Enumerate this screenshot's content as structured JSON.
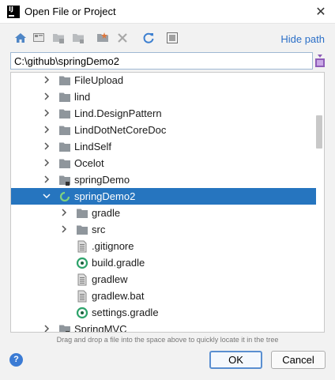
{
  "window": {
    "title": "Open File or Project",
    "close_glyph": "✕"
  },
  "toolbar": {
    "icons": [
      "home-icon",
      "desktop-icon",
      "project-folder-icon",
      "module-folder-icon",
      "new-folder-icon",
      "delete-icon",
      "refresh-icon",
      "show-hidden-icon"
    ],
    "hide_path_label": "Hide path"
  },
  "path": {
    "value": "C:\\github\\springDemo2"
  },
  "tree": {
    "items": [
      {
        "label": "FileUpload",
        "kind": "folder",
        "expandable": true,
        "expanded": false,
        "selected": false
      },
      {
        "label": "lind",
        "kind": "folder",
        "expandable": true,
        "expanded": false,
        "selected": false
      },
      {
        "label": "Lind.DesignPattern",
        "kind": "folder",
        "expandable": true,
        "expanded": false,
        "selected": false
      },
      {
        "label": "LindDotNetCoreDoc",
        "kind": "folder",
        "expandable": true,
        "expanded": false,
        "selected": false
      },
      {
        "label": "LindSelf",
        "kind": "folder",
        "expandable": true,
        "expanded": false,
        "selected": false
      },
      {
        "label": "Ocelot",
        "kind": "folder",
        "expandable": true,
        "expanded": false,
        "selected": false
      },
      {
        "label": "springDemo",
        "kind": "project-folder",
        "expandable": true,
        "expanded": false,
        "selected": false
      },
      {
        "label": "springDemo2",
        "kind": "loading",
        "expandable": true,
        "expanded": true,
        "selected": true
      },
      {
        "label": "gradle",
        "kind": "folder",
        "expandable": true,
        "expanded": false,
        "selected": false
      },
      {
        "label": "src",
        "kind": "folder",
        "expandable": true,
        "expanded": false,
        "selected": false
      },
      {
        "label": ".gitignore",
        "kind": "file",
        "expandable": false,
        "expanded": false,
        "selected": false
      },
      {
        "label": "build.gradle",
        "kind": "gradle",
        "expandable": false,
        "expanded": false,
        "selected": false
      },
      {
        "label": "gradlew",
        "kind": "file",
        "expandable": false,
        "expanded": false,
        "selected": false
      },
      {
        "label": "gradlew.bat",
        "kind": "file",
        "expandable": false,
        "expanded": false,
        "selected": false
      },
      {
        "label": "settings.gradle",
        "kind": "gradle",
        "expandable": false,
        "expanded": false,
        "selected": false
      },
      {
        "label": "SpringMVC",
        "kind": "project-folder",
        "expandable": true,
        "expanded": false,
        "selected": false
      }
    ]
  },
  "hint": "Drag and drop a file into the space above to quickly locate it in the tree",
  "footer": {
    "help_glyph": "?",
    "ok_label": "OK",
    "cancel_label": "Cancel"
  },
  "colors": {
    "selection": "#2675bf",
    "link": "#2b6fc7",
    "folder": "#8f969c",
    "gradle": "#2ea36b",
    "ok_border": "#5a8fd1"
  }
}
